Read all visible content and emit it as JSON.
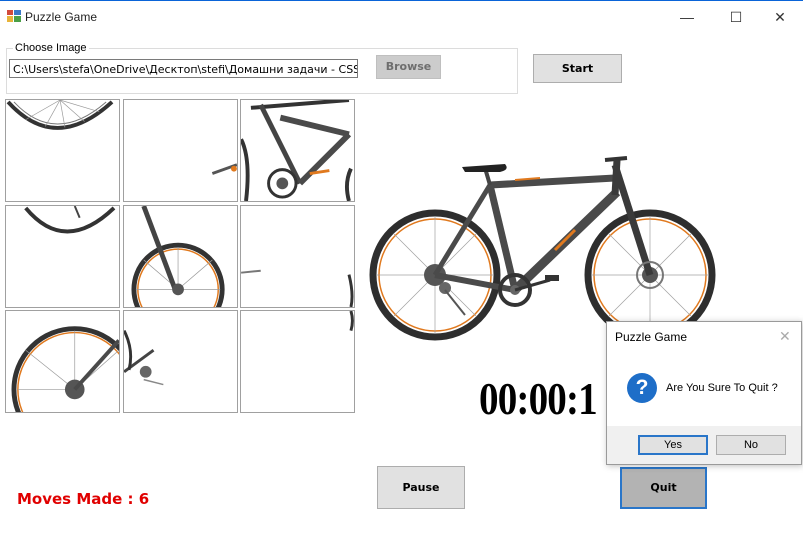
{
  "window": {
    "title": "Puzzle Game",
    "minimize": "—",
    "maximize": "☐",
    "close": "✕"
  },
  "image_group": {
    "label": "Choose Image",
    "path_value": "C:\\Users\\stefa\\OneDrive\\Десктоп\\stefi\\Домашни задачи - CSS основи\\s",
    "browse_label": "Browse"
  },
  "start_label": "Start",
  "timer": "00:00:1",
  "moves": {
    "label": "Moves Made : ",
    "count": "6"
  },
  "pause_label": "Pause",
  "quit_label": "Quit",
  "dialog": {
    "title": "Puzzle Game",
    "close": "✕",
    "icon": "question-icon",
    "icon_glyph": "?",
    "message": "Are You Sure To Quit ?",
    "yes_label": "Yes",
    "no_label": "No"
  },
  "colors": {
    "accent": "#2a76c9",
    "moves_text": "#e00000",
    "bike_frame": "#4a4a4a",
    "bike_accent": "#e0791e"
  }
}
